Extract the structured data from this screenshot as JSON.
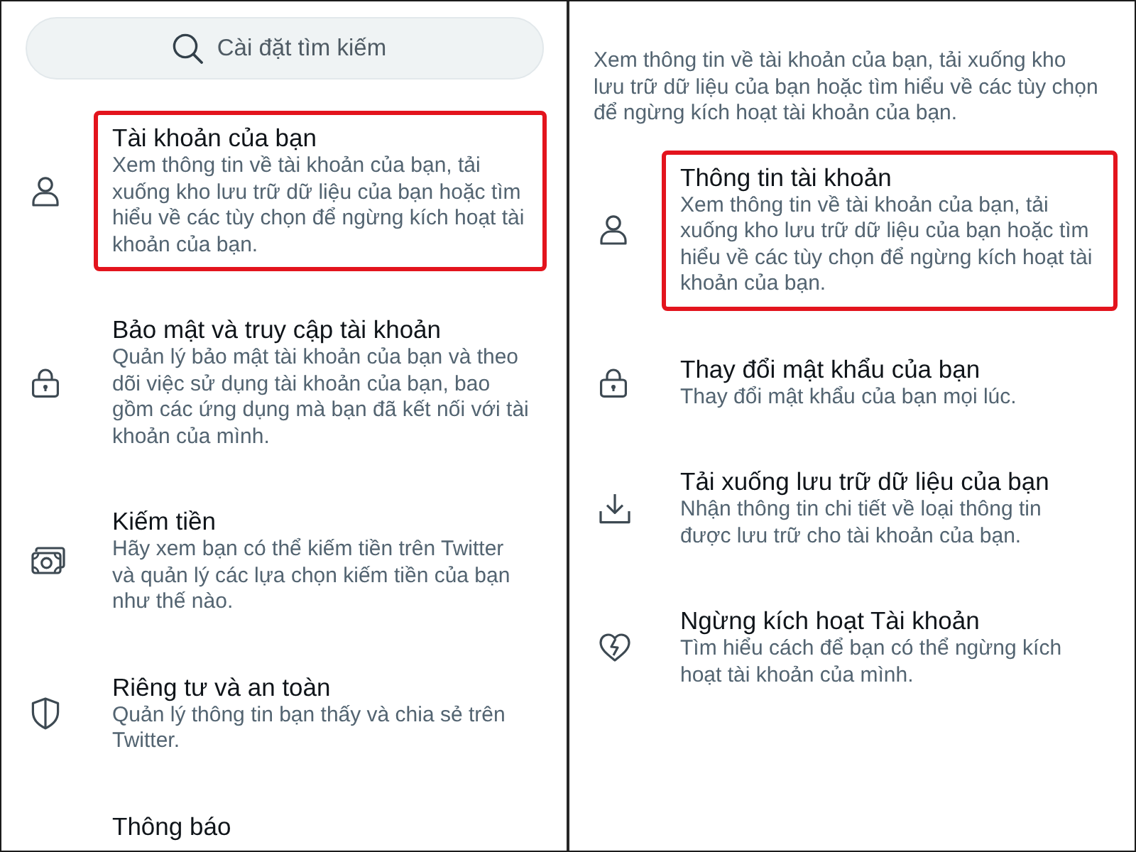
{
  "left": {
    "search": {
      "placeholder": "Cài đặt tìm kiếm"
    },
    "items": [
      {
        "kind": "account",
        "title": "Tài khoản của bạn",
        "description": "Xem thông tin về tài khoản của bạn, tải xuống kho lưu trữ dữ liệu của bạn hoặc tìm hiểu về các tùy chọn để ngừng kích hoạt tài khoản của bạn.",
        "highlighted": true
      },
      {
        "kind": "security",
        "title": "Bảo mật và truy cập tài khoản",
        "description": "Quản lý bảo mật tài khoản của bạn và theo dõi việc sử dụng tài khoản của bạn, bao gồm các ứng dụng mà bạn đã kết nối với tài khoản của mình.",
        "highlighted": false
      },
      {
        "kind": "monetization",
        "title": "Kiếm tiền",
        "description": "Hãy xem bạn có thể kiếm tiền trên Twitter và quản lý các lựa chọn kiếm tiền của bạn như thế nào.",
        "highlighted": false
      },
      {
        "kind": "privacy",
        "title": "Riêng tư và an toàn",
        "description": "Quản lý thông tin bạn thấy và chia sẻ trên Twitter.",
        "highlighted": false
      },
      {
        "title": "Thông báo",
        "highlighted": false
      }
    ]
  },
  "right": {
    "intro": "Xem thông tin về tài khoản của bạn, tải xuống kho lưu trữ dữ liệu của bạn hoặc tìm hiểu về các tùy chọn để ngừng kích hoạt tài khoản của bạn.",
    "items": [
      {
        "kind": "account",
        "title": "Thông tin tài khoản",
        "description": "Xem thông tin về tài khoản của bạn, tải xuống kho lưu trữ dữ liệu của bạn hoặc tìm hiểu về các tùy chọn để ngừng kích hoạt tài khoản của bạn.",
        "highlighted": true
      },
      {
        "kind": "password",
        "title": "Thay đổi mật khẩu của bạn",
        "description": "Thay đổi mật khẩu của bạn mọi lúc.",
        "highlighted": false
      },
      {
        "kind": "download",
        "title": "Tải xuống lưu trữ dữ liệu của bạn",
        "description": "Nhận thông tin chi tiết về loại thông tin được lưu trữ cho tài khoản của bạn.",
        "highlighted": false
      },
      {
        "kind": "deactivate",
        "title": "Ngừng kích hoạt Tài khoản",
        "description": "Tìm hiểu cách để bạn có thể ngừng kích hoạt tài khoản của mình.",
        "highlighted": false
      }
    ]
  }
}
